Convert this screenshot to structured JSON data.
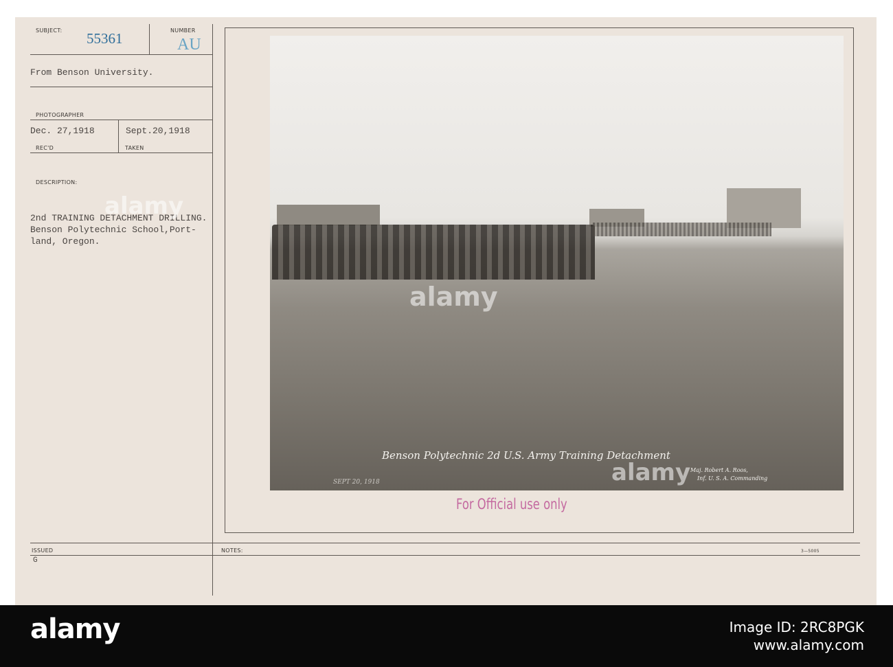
{
  "card": {
    "subject_label": "SUBJECT:",
    "subject_number": "55361",
    "number_label": "NUMBER",
    "number_code": "AU",
    "source": "From Benson University.",
    "photographer_label": "PHOTOGRAPHER",
    "received_date": "Dec. 27,1918",
    "received_label": "REC'D",
    "taken_date": "Sept.20,1918",
    "taken_label": "TAKEN",
    "description_label": "DESCRIPTION:",
    "description_lines": [
      "2nd TRAINING DETACHMENT DRILLING.",
      "Benson Polytechnic School,Port-",
      "land, Oregon."
    ],
    "issued_label": "ISSUED",
    "issued_value": "G",
    "notes_label": "NOTES:",
    "form_number": "3—5005",
    "stamp": "For Official use only"
  },
  "photo": {
    "caption": "Benson Polytechnic 2d U.S. Army Training Detachment",
    "date_inscription": "SEPT 20, 1918",
    "commander_line1": "Maj. Robert A. Roos,",
    "commander_line2": "Inf. U. S. A. Commanding"
  },
  "footer": {
    "logo": "alamy",
    "image_id_label": "Image ID: 2RC8PGK",
    "site": "www.alamy.com"
  },
  "watermark": "alamy"
}
